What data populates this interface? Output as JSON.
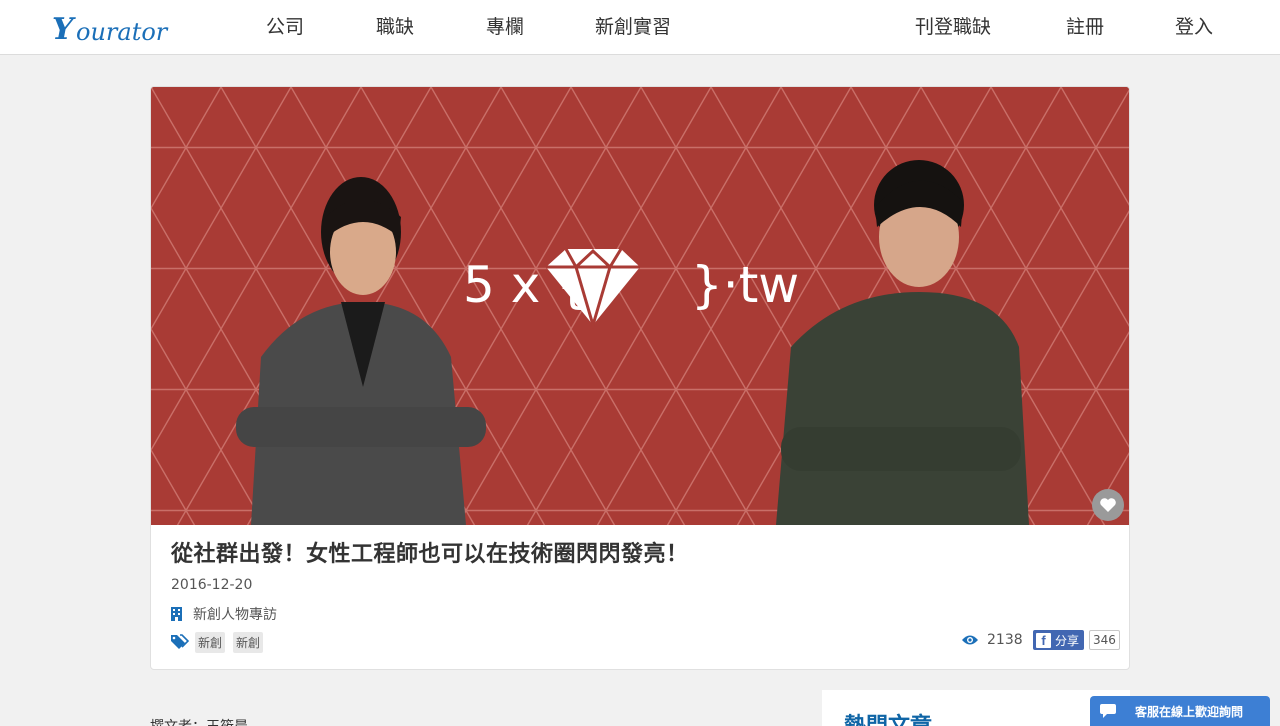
{
  "nav": {
    "logo_text": "Yourator",
    "links": [
      "公司",
      "職缺",
      "專欄",
      "新創實習"
    ],
    "right_links": [
      "刊登職缺",
      "註冊",
      "登入"
    ]
  },
  "article": {
    "hero_text": "5 x {",
    "hero_text_end": "}·tw",
    "title": "從社群出發！女性工程師也可以在技術圈閃閃發亮！",
    "date": "2016-12-20",
    "category": "新創人物專訪",
    "tags": [
      "新創",
      "新創"
    ],
    "views": "2138",
    "share_label": "分享",
    "share_count": "346"
  },
  "body": {
    "author_line": "撰文者：王筱晨"
  },
  "sidebar": {
    "title": "熱門文章"
  },
  "chat": {
    "label": "客服在線上歡迎詢問"
  },
  "colors": {
    "brand_blue": "#0f65a6",
    "hero_red": "#a93b35",
    "fb_blue": "#4267b2",
    "chat_blue": "#3d7fd4"
  }
}
